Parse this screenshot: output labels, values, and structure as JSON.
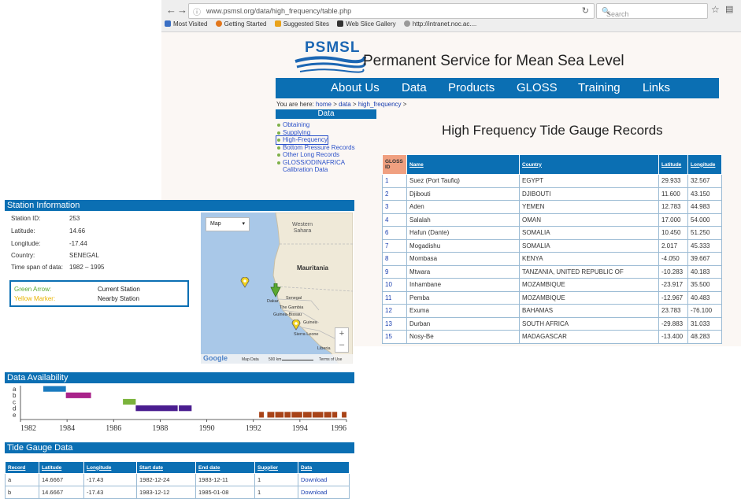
{
  "browser": {
    "url": "www.psmsl.org/data/high_frequency/table.php",
    "search_placeholder": "Search",
    "bookmarks": [
      "Most Visited",
      "Getting Started",
      "Suggested Sites",
      "Web Slice Gallery",
      "http://intranet.noc.ac...."
    ]
  },
  "site": {
    "logo_text": "PSMSL",
    "title": "Permanent Service for Mean Sea Level",
    "nav": [
      "About Us",
      "Data",
      "Products",
      "GLOSS",
      "Training",
      "Links"
    ],
    "breadcrumb_prefix": "You are here:",
    "breadcrumb": [
      "home",
      "data",
      "high_frequency"
    ],
    "sidebar_title": "Data",
    "sidebar_items": [
      "Obtaining",
      "Supplying",
      "High-Frequency",
      "Bottom Pressure Records",
      "Other Long Records",
      "GLOSS/ODINAFRICA",
      "Calibration Data"
    ],
    "page_heading": "High Frequency Tide Gauge Records"
  },
  "hf_table": {
    "headers": [
      "GLOSS ID",
      "Name",
      "Country",
      "Latitude",
      "Longitude"
    ],
    "rows": [
      [
        "1",
        "Suez (Port Taufiq)",
        "EGYPT",
        "29.933",
        "32.567"
      ],
      [
        "2",
        "Djibouti",
        "DJIBOUTI",
        "11.600",
        "43.150"
      ],
      [
        "3",
        "Aden",
        "YEMEN",
        "12.783",
        "44.983"
      ],
      [
        "4",
        "Salalah",
        "OMAN",
        "17.000",
        "54.000"
      ],
      [
        "6",
        "Hafun (Dante)",
        "SOMALIA",
        "10.450",
        "51.250"
      ],
      [
        "7",
        "Mogadishu",
        "SOMALIA",
        "2.017",
        "45.333"
      ],
      [
        "8",
        "Mombasa",
        "KENYA",
        "-4.050",
        "39.667"
      ],
      [
        "9",
        "Mtwara",
        "TANZANIA, UNITED REPUBLIC OF",
        "-10.283",
        "40.183"
      ],
      [
        "10",
        "Inhambane",
        "MOZAMBIQUE",
        "-23.917",
        "35.500"
      ],
      [
        "11",
        "Pemba",
        "MOZAMBIQUE",
        "-12.967",
        "40.483"
      ],
      [
        "12",
        "Exuma",
        "BAHAMAS",
        "23.783",
        "-76.100"
      ],
      [
        "13",
        "Durban",
        "SOUTH AFRICA",
        "-29.883",
        "31.033"
      ],
      [
        "15",
        "Nosy-Be",
        "MADAGASCAR",
        "-13.400",
        "48.283"
      ]
    ]
  },
  "station": {
    "section_title": "Station Information",
    "fields": [
      {
        "label": "Station ID:",
        "value": "253"
      },
      {
        "label": "Latitude:",
        "value": "14.66"
      },
      {
        "label": "Longitude:",
        "value": "-17.44"
      },
      {
        "label": "Country:",
        "value": "SENEGAL"
      },
      {
        "label": "Time span of data:",
        "value": "1982 – 1995"
      }
    ],
    "legend": [
      {
        "key": "Green Arrow:",
        "desc": "Current Station",
        "color": "#5aa832"
      },
      {
        "key": "Yellow Marker:",
        "desc": "Nearby Station",
        "color": "#e8b400"
      }
    ],
    "map": {
      "type_button": "Map",
      "labels": [
        "Western Sahara",
        "Mauritania",
        "Dakar",
        "Senegal",
        "The Gambia",
        "Guinea-Bissau",
        "Guinea",
        "Sierra Leone",
        "Liberia"
      ],
      "attribution": [
        "Google",
        "Map Data",
        "500 km",
        "Terms of Use"
      ],
      "zoom": [
        "+",
        "–"
      ]
    }
  },
  "availability": {
    "section_title": "Data Availability",
    "rows": [
      "a",
      "b",
      "c",
      "d",
      "e"
    ],
    "x_ticks": [
      "1982",
      "1984",
      "1986",
      "1988",
      "1990",
      "1992",
      "1994",
      "1996"
    ],
    "xlim": [
      1982,
      1996
    ],
    "segments": [
      {
        "row": "a",
        "start": 1982.98,
        "end": 1983.95,
        "color": "#1a7bbf"
      },
      {
        "row": "b",
        "start": 1983.95,
        "end": 1985.03,
        "color": "#a9238a"
      },
      {
        "row": "c",
        "start": 1986.4,
        "end": 1986.95,
        "color": "#7ab33b"
      },
      {
        "row": "d",
        "start": 1986.95,
        "end": 1988.75,
        "color": "#4a1d8f"
      },
      {
        "row": "d",
        "start": 1988.8,
        "end": 1989.35,
        "color": "#4a1d8f"
      },
      {
        "row": "e",
        "start": 1992.25,
        "end": 1992.45,
        "color": "#a84318"
      },
      {
        "row": "e",
        "start": 1992.6,
        "end": 1995.6,
        "color": "#a84318"
      },
      {
        "row": "e",
        "start": 1995.8,
        "end": 1996.0,
        "color": "#a84318"
      }
    ]
  },
  "tide_table": {
    "section_title": "Tide Gauge Data",
    "headers": [
      "Record",
      "Latitude",
      "Longitude",
      "Start date",
      "End date",
      "Supplier",
      "Data"
    ],
    "rows": [
      [
        "a",
        "14.6667",
        "-17.43",
        "1982-12-24",
        "1983-12-11",
        "1",
        "Download"
      ],
      [
        "b",
        "14.6667",
        "-17.43",
        "1983-12-12",
        "1985-01-08",
        "1",
        "Download"
      ]
    ]
  }
}
